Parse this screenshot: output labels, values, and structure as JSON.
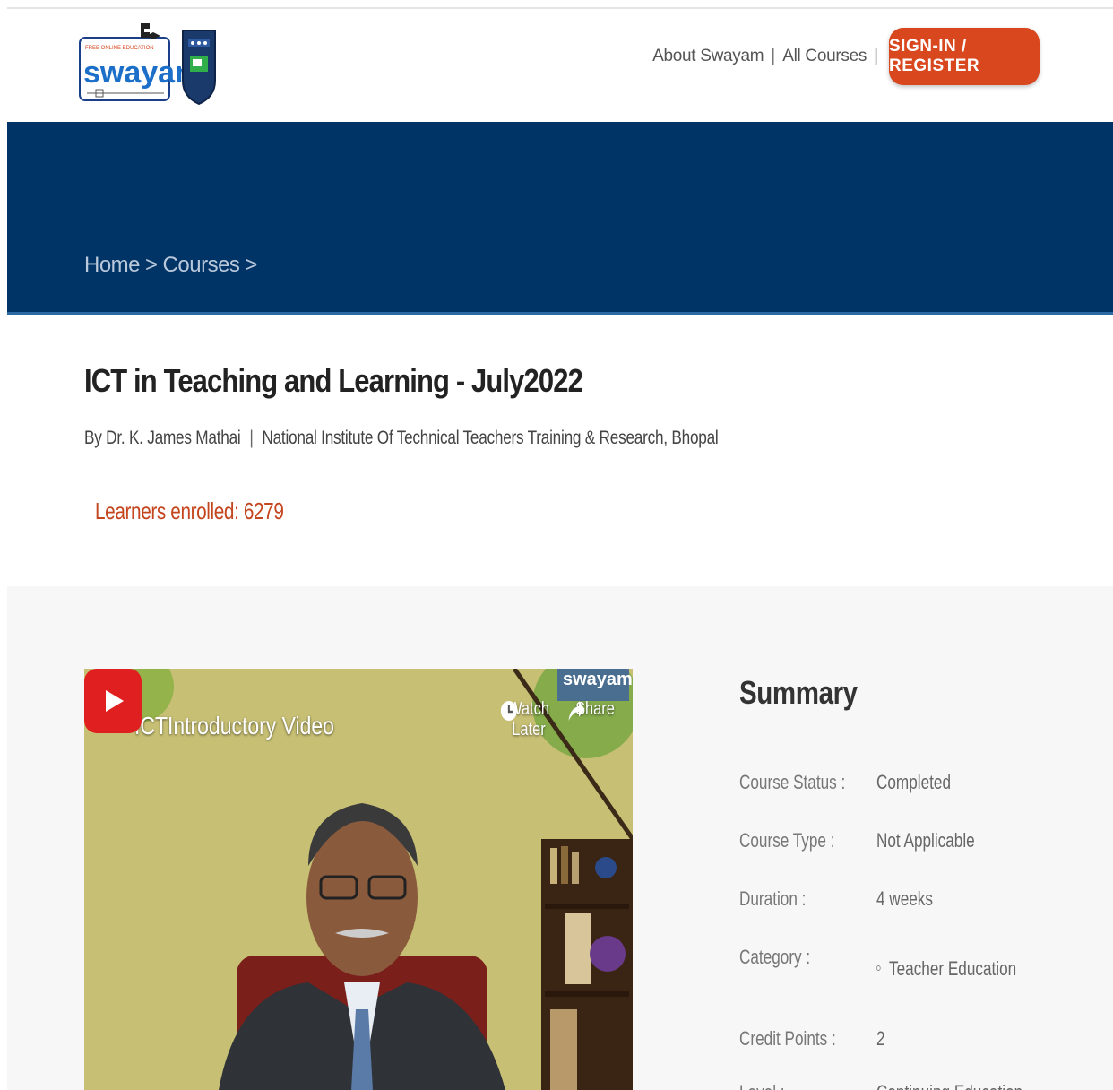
{
  "header": {
    "logo_text": "swayam",
    "logo_tagline": "FREE ONLINE EDUCATION",
    "nav": {
      "about": "About Swayam",
      "all_courses": "All Courses",
      "separator": "|",
      "signin": "SIGN-IN / REGISTER"
    }
  },
  "breadcrumb": {
    "home": "Home",
    "courses": "Courses",
    "sep": ">"
  },
  "course": {
    "title": "ICT in Teaching and Learning - July2022",
    "instructor": "By Dr. K. James Mathai",
    "pipe": "|",
    "institute": "National Institute Of Technical Teachers Training & Research, Bhopal",
    "enrolled": "Learners enrolled: 6279"
  },
  "video": {
    "title": "ICTIntroductory Video",
    "watch_later": "Watch Later",
    "share": "Share",
    "watermark": "swayam"
  },
  "summary": {
    "title": "Summary",
    "rows": [
      {
        "label": "Course Status :",
        "value": "Completed"
      },
      {
        "label": "Course Type :",
        "value": "Not Applicable"
      },
      {
        "label": "Duration :",
        "value": "4 weeks"
      },
      {
        "label": "Category :",
        "value": "Teacher Education"
      },
      {
        "label": "Credit Points :",
        "value": "2"
      },
      {
        "label": "Level :",
        "value": "Continuing Education"
      }
    ]
  },
  "colors": {
    "banner": "#003366",
    "accent": "#d9471e",
    "enrolled": "#c4461f"
  }
}
